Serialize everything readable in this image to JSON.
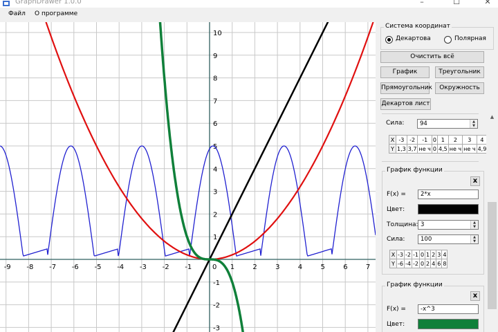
{
  "window": {
    "title": "GraphDrawer 1.0.0",
    "minimize": "–",
    "maximize": "☐",
    "close": "✕"
  },
  "menu": [
    "Файл",
    "О программе"
  ],
  "coords": {
    "title": "Система координат",
    "options": [
      "Декартова",
      "Полярная"
    ],
    "selected": 0
  },
  "buttons": {
    "clear": "Очистить всё",
    "graph": "График",
    "triangle": "Треугольник",
    "rectangle": "Прямоугольник",
    "circle": "Окружность",
    "folium": "Декартов лист"
  },
  "block1": {
    "strength_label": "Сила:",
    "strength": "94",
    "table_x": [
      "X",
      "-3",
      "-2",
      "-1",
      "0",
      "1",
      "2",
      "3",
      "4"
    ],
    "table_y": [
      "Y",
      "1,3",
      "3,7",
      "не ч",
      "0",
      "4,5",
      "не ч",
      "не ч",
      "4,9"
    ]
  },
  "block2": {
    "title": "График функции",
    "close": "x",
    "fx_label": "F(x) =",
    "fx": "2*x",
    "color_label": "Цвет:",
    "color": "#000000",
    "thickness_label": "Толщина:",
    "thickness": "3",
    "strength_label": "Сила:",
    "strength": "100",
    "table_x": [
      "X",
      "-3",
      "-2",
      "-1",
      "0",
      "1",
      "2",
      "3",
      "4"
    ],
    "table_y": [
      "Y",
      "-6",
      "-4",
      "-2",
      "0",
      "2",
      "4",
      "6",
      "8"
    ]
  },
  "block3": {
    "title": "График функции",
    "close": "x",
    "fx_label": "F(x) =",
    "fx": "-x^3",
    "color_label": "Цвет:",
    "color": "#10803a"
  },
  "graph": {
    "x_ticks": [
      "-9",
      "-8",
      "-7",
      "-6",
      "-5",
      "-4",
      "-3",
      "-2",
      "-1",
      "0",
      "1",
      "2",
      "3",
      "4",
      "5",
      "6",
      "7"
    ],
    "y_ticks": [
      "10",
      "9",
      "8",
      "7",
      "6",
      "5",
      "4",
      "3",
      "2",
      "1",
      "-1",
      "-2",
      "-3"
    ],
    "curve_colors": {
      "parabola": "#e01010",
      "line": "#000000",
      "cubic": "#10803a",
      "wave": "#2020d0"
    }
  }
}
